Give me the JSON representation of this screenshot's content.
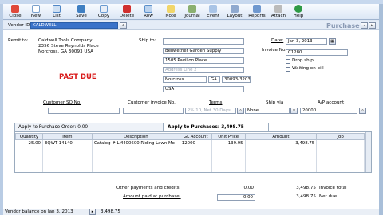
{
  "toolbar": {
    "items": [
      {
        "label": "Close",
        "icon": "close-icon",
        "color": "#d83b2a"
      },
      {
        "label": "New",
        "icon": "new-icon",
        "color": "#3a8ad8"
      },
      {
        "label": "List",
        "icon": "list-icon",
        "color": "#4f86c6"
      },
      {
        "label": "Save",
        "icon": "save-icon",
        "color": "#3f7fc2"
      },
      {
        "label": "Copy",
        "icon": "copy-icon",
        "color": "#6a9ad0"
      },
      {
        "label": "Delete",
        "icon": "delete-icon",
        "color": "#d03030"
      },
      {
        "label": "Row",
        "icon": "row-icon",
        "color": "#5b8fc9"
      },
      {
        "label": "Note",
        "icon": "note-icon",
        "color": "#e8c74a"
      },
      {
        "label": "Journal",
        "icon": "journal-icon",
        "color": "#6d9a53"
      },
      {
        "label": "Event",
        "icon": "event-icon",
        "color": "#7aa3d6"
      },
      {
        "label": "Layout",
        "icon": "layout-icon",
        "color": "#6f8fbf"
      },
      {
        "label": "Reports",
        "icon": "reports-icon",
        "color": "#4c7fbf"
      },
      {
        "label": "Attach",
        "icon": "attach-icon",
        "color": "#8b8b8b"
      },
      {
        "label": "Help",
        "icon": "help-icon",
        "color": "#2f9a45"
      }
    ]
  },
  "header": {
    "vendor_id_label": "Vendor ID:",
    "vendor_id_value": "CALDWELL",
    "form_title": "Purchase"
  },
  "remit": {
    "label": "Remit to:",
    "lines": [
      "Caldwell Tools Company",
      "2356 Steve Reynolds Place",
      "Norcross, GA 30093 USA"
    ],
    "status": "PAST DUE",
    "status_color": "#d81818"
  },
  "ship_to": {
    "label": "Ship to:",
    "name": "Bellwether Garden Supply",
    "address1": "1505 Pavilion Place",
    "address2_placeholder": "Address Line 2",
    "city": "Norcross",
    "state": "GA",
    "zip": "30093-3203",
    "country": "USA"
  },
  "invoice_meta": {
    "date_label": "Date:",
    "date_value": "Jan 3, 2013",
    "invoice_label": "Invoice No.:",
    "invoice_value": "C1280",
    "drop_ship_label": "Drop ship",
    "waiting_label": "Waiting on bill"
  },
  "order_info": {
    "customer_so_label": "Customer SO No.",
    "customer_invoice_label": "Customer invoice No.",
    "terms_label": "Terms",
    "terms_value": "2% 10, Net 30 Days",
    "ship_via_label": "Ship via",
    "ship_via_value": "None",
    "ap_account_label": "A/P account",
    "ap_account_value": "20000"
  },
  "tabs": [
    {
      "label": "Apply to Purchase Order: 0.00"
    },
    {
      "label": "Apply to Purchases: 3,498.75"
    }
  ],
  "grid": {
    "columns": [
      "Quantity",
      "Item",
      "Description",
      "GL Account",
      "Unit Price",
      "Amount",
      "Job"
    ],
    "rows": [
      [
        "25.00",
        "EQWT-14140",
        "Catalog # LM400600 Riding Lawn Mo",
        "12000",
        "139.95",
        "3,498.75",
        ""
      ]
    ]
  },
  "totals": {
    "other_label": "Other payments and credits:",
    "other_value": "0.00",
    "invoice_total_value": "3,498.75",
    "invoice_total_label": "Invoice total",
    "amount_paid_label": "Amount paid at purchase:",
    "amount_paid_value": "0.00",
    "net_due_value": "3,498.75",
    "net_due_label": "Net due"
  },
  "status": {
    "vendor_balance_label": "Vendor balance on Jan 3, 2013",
    "vendor_balance_value": "3,498.75"
  }
}
